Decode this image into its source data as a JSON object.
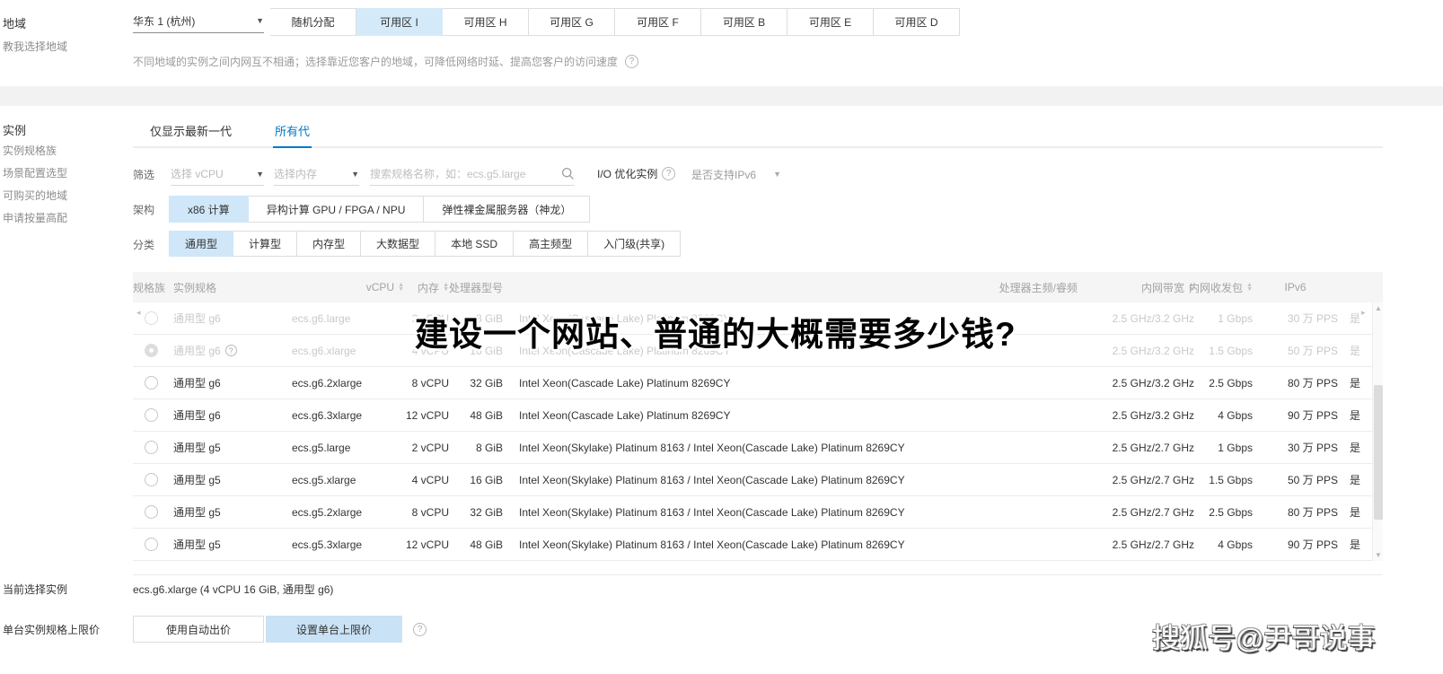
{
  "colors": {
    "accent_blue": "#0079c9",
    "selected_chip_bg": "#cfe7f8",
    "zone_selected_bg": "#d5eaf8",
    "header_bg": "#f5f5f5"
  },
  "icons": {
    "dropdown": "▼",
    "sort_up": "▲",
    "sort_down": "▼",
    "help": "?",
    "search": "magnifier",
    "scroll_up": "▲",
    "scroll_down": "▼",
    "scroll_left": "◂",
    "scroll_right": "▸"
  },
  "sidebar": {
    "region_label": "地域",
    "region_help_link": "教我选择地域",
    "instance_label": "实例",
    "links": [
      "实例规格族",
      "场景配置选型",
      "可购买的地域",
      "申请按量高配"
    ],
    "current_instance_label": "当前选择实例",
    "price_cap_label": "单台实例规格上限价"
  },
  "region": {
    "selected": "华东 1 (杭州)",
    "zones": [
      {
        "label": "随机分配",
        "active": false
      },
      {
        "label": "可用区 I",
        "active": true
      },
      {
        "label": "可用区 H",
        "active": false
      },
      {
        "label": "可用区 G",
        "active": false
      },
      {
        "label": "可用区 F",
        "active": false
      },
      {
        "label": "可用区 B",
        "active": false
      },
      {
        "label": "可用区 E",
        "active": false
      },
      {
        "label": "可用区 D",
        "active": false
      }
    ],
    "hint": "不同地域的实例之间内网互不相通；选择靠近您客户的地域，可降低网络时延、提高您客户的访问速度"
  },
  "tabs": [
    {
      "label": "仅显示最新一代",
      "active": false
    },
    {
      "label": "所有代",
      "active": true
    }
  ],
  "filter": {
    "label": "筛选",
    "vcpu_placeholder": "选择 vCPU",
    "mem_placeholder": "选择内存",
    "search_placeholder": "搜索规格名称，如：ecs.g5.large",
    "io_label": "I/O 优化实例",
    "ipv6_label": "是否支持IPv6"
  },
  "arch": {
    "label": "架构",
    "options": [
      {
        "label": "x86 计算",
        "active": true
      },
      {
        "label": "异构计算 GPU / FPGA / NPU",
        "active": false
      },
      {
        "label": "弹性裸金属服务器（神龙）",
        "active": false
      }
    ]
  },
  "category": {
    "label": "分类",
    "options": [
      {
        "label": "通用型",
        "active": true
      },
      {
        "label": "计算型",
        "active": false
      },
      {
        "label": "内存型",
        "active": false
      },
      {
        "label": "大数据型",
        "active": false
      },
      {
        "label": "本地 SSD",
        "active": false
      },
      {
        "label": "高主频型",
        "active": false
      },
      {
        "label": "入门级(共享)",
        "active": false
      }
    ]
  },
  "table": {
    "headers": [
      {
        "label": "规格族",
        "sortable": false
      },
      {
        "label": "实例规格",
        "sortable": false
      },
      {
        "label": "vCPU",
        "sortable": true
      },
      {
        "label": "内存",
        "sortable": true
      },
      {
        "label": "处理器型号",
        "sortable": false
      },
      {
        "label": "处理器主频/睿频",
        "sortable": false
      },
      {
        "label": "内网带宽",
        "sortable": true
      },
      {
        "label": "内网收发包",
        "sortable": true
      },
      {
        "label": "IPv6",
        "sortable": false
      }
    ],
    "rows": [
      {
        "family": "通用型 g6",
        "spec": "ecs.g6.large",
        "vcpu": "2 vCPU",
        "mem": "8 GiB",
        "cpu": "Intel Xeon(Cascade Lake) Platinum 8269CY",
        "freq": "2.5 GHz/3.2 GHz",
        "bw": "1 Gbps",
        "pps": "30 万 PPS",
        "ipv6": "是",
        "muted": true,
        "selected": false,
        "help": false
      },
      {
        "family": "通用型 g6",
        "spec": "ecs.g6.xlarge",
        "vcpu": "4 vCPU",
        "mem": "16 GiB",
        "cpu": "Intel Xeon(Cascade Lake) Platinum 8269CY",
        "freq": "2.5 GHz/3.2 GHz",
        "bw": "1.5 Gbps",
        "pps": "50 万 PPS",
        "ipv6": "是",
        "muted": true,
        "selected": true,
        "help": true
      },
      {
        "family": "通用型 g6",
        "spec": "ecs.g6.2xlarge",
        "vcpu": "8 vCPU",
        "mem": "32 GiB",
        "cpu": "Intel Xeon(Cascade Lake) Platinum 8269CY",
        "freq": "2.5 GHz/3.2 GHz",
        "bw": "2.5 Gbps",
        "pps": "80 万 PPS",
        "ipv6": "是",
        "muted": false,
        "selected": false,
        "help": false
      },
      {
        "family": "通用型 g6",
        "spec": "ecs.g6.3xlarge",
        "vcpu": "12 vCPU",
        "mem": "48 GiB",
        "cpu": "Intel Xeon(Cascade Lake) Platinum 8269CY",
        "freq": "2.5 GHz/3.2 GHz",
        "bw": "4 Gbps",
        "pps": "90 万 PPS",
        "ipv6": "是",
        "muted": false,
        "selected": false,
        "help": false
      },
      {
        "family": "通用型 g5",
        "spec": "ecs.g5.large",
        "vcpu": "2 vCPU",
        "mem": "8 GiB",
        "cpu": "Intel Xeon(Skylake) Platinum 8163 / Intel Xeon(Cascade Lake) Platinum 8269CY",
        "freq": "2.5 GHz/2.7 GHz",
        "bw": "1 Gbps",
        "pps": "30 万 PPS",
        "ipv6": "是",
        "muted": false,
        "selected": false,
        "help": false
      },
      {
        "family": "通用型 g5",
        "spec": "ecs.g5.xlarge",
        "vcpu": "4 vCPU",
        "mem": "16 GiB",
        "cpu": "Intel Xeon(Skylake) Platinum 8163 / Intel Xeon(Cascade Lake) Platinum 8269CY",
        "freq": "2.5 GHz/2.7 GHz",
        "bw": "1.5 Gbps",
        "pps": "50 万 PPS",
        "ipv6": "是",
        "muted": false,
        "selected": false,
        "help": false
      },
      {
        "family": "通用型 g5",
        "spec": "ecs.g5.2xlarge",
        "vcpu": "8 vCPU",
        "mem": "32 GiB",
        "cpu": "Intel Xeon(Skylake) Platinum 8163 / Intel Xeon(Cascade Lake) Platinum 8269CY",
        "freq": "2.5 GHz/2.7 GHz",
        "bw": "2.5 Gbps",
        "pps": "80 万 PPS",
        "ipv6": "是",
        "muted": false,
        "selected": false,
        "help": false
      },
      {
        "family": "通用型 g5",
        "spec": "ecs.g5.3xlarge",
        "vcpu": "12 vCPU",
        "mem": "48 GiB",
        "cpu": "Intel Xeon(Skylake) Platinum 8163 / Intel Xeon(Cascade Lake) Platinum 8269CY",
        "freq": "2.5 GHz/2.7 GHz",
        "bw": "4 Gbps",
        "pps": "90 万 PPS",
        "ipv6": "是",
        "muted": false,
        "selected": false,
        "help": false
      }
    ]
  },
  "overlay_caption": "建设一个网站、普通的大概需要多少钱?",
  "footer": {
    "current_value": "ecs.g6.xlarge (4 vCPU 16 GiB, 通用型 g6)",
    "auto_bid_button": "使用自动出价",
    "set_cap_button": "设置单台上限价"
  },
  "watermark": "搜狐号@尹哥说事"
}
